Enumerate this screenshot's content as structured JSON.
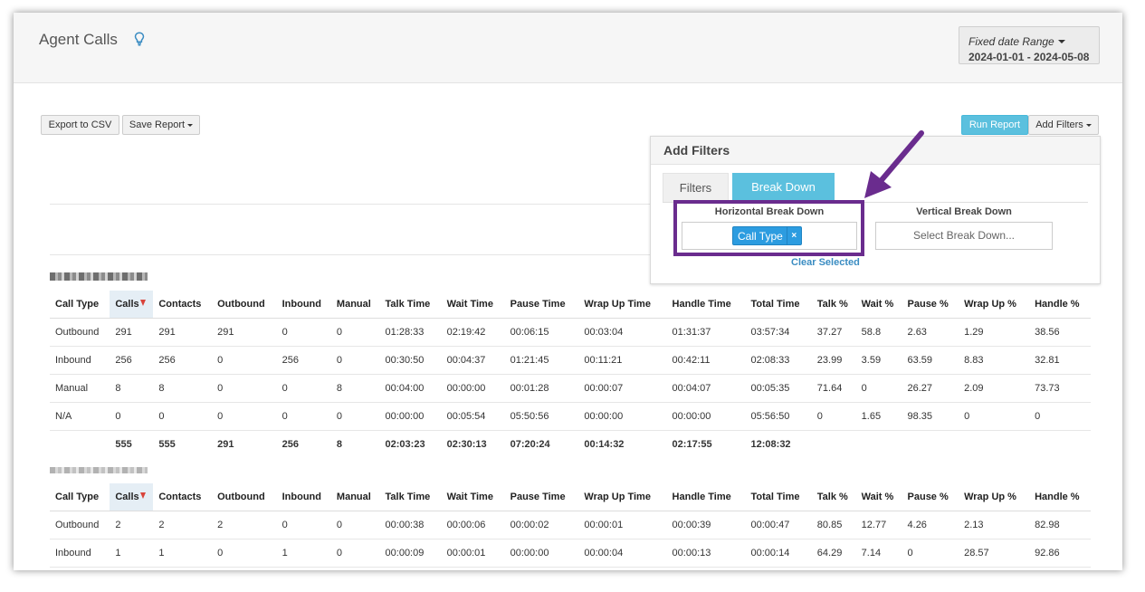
{
  "header": {
    "title": "Agent Calls",
    "date_range_label": "Fixed date Range",
    "date_range_value": "2024-01-01 - 2024-05-08"
  },
  "toolbar": {
    "export_label": "Export to CSV",
    "save_label": "Save Report",
    "run_label": "Run Report",
    "add_filters_label": "Add Filters"
  },
  "filter_panel": {
    "title": "Add Filters",
    "tab_filters": "Filters",
    "tab_breakdown": "Break Down",
    "horizontal_label": "Horizontal Break Down",
    "vertical_label": "Vertical Break Down",
    "chip_label": "Call Type",
    "chip_remove": "×",
    "vertical_placeholder": "Select Break Down...",
    "clear_label": "Clear Selected",
    "highlight_color": "#6a2c8e",
    "accent_color": "#5bc0de"
  },
  "columns": [
    "Call Type",
    "Calls",
    "Contacts",
    "Outbound",
    "Inbound",
    "Manual",
    "Talk Time",
    "Wait Time",
    "Pause Time",
    "Wrap Up Time",
    "Handle Time",
    "Total Time",
    "Talk %",
    "Wait %",
    "Pause %",
    "Wrap Up %",
    "Handle %"
  ],
  "table1": {
    "rows": [
      [
        "Outbound",
        "291",
        "291",
        "291",
        "0",
        "0",
        "01:28:33",
        "02:19:42",
        "00:06:15",
        "00:03:04",
        "01:31:37",
        "03:57:34",
        "37.27",
        "58.8",
        "2.63",
        "1.29",
        "38.56"
      ],
      [
        "Inbound",
        "256",
        "256",
        "0",
        "256",
        "0",
        "00:30:50",
        "00:04:37",
        "01:21:45",
        "00:11:21",
        "00:42:11",
        "02:08:33",
        "23.99",
        "3.59",
        "63.59",
        "8.83",
        "32.81"
      ],
      [
        "Manual",
        "8",
        "8",
        "0",
        "0",
        "8",
        "00:04:00",
        "00:00:00",
        "00:01:28",
        "00:00:07",
        "00:04:07",
        "00:05:35",
        "71.64",
        "0",
        "26.27",
        "2.09",
        "73.73"
      ],
      [
        "N/A",
        "0",
        "0",
        "0",
        "0",
        "0",
        "00:00:00",
        "00:05:54",
        "05:50:56",
        "00:00:00",
        "00:00:00",
        "05:56:50",
        "0",
        "1.65",
        "98.35",
        "0",
        "0"
      ]
    ],
    "total": [
      "",
      "555",
      "555",
      "291",
      "256",
      "8",
      "02:03:23",
      "02:30:13",
      "07:20:24",
      "00:14:32",
      "02:17:55",
      "12:08:32",
      "",
      "",
      "",
      "",
      ""
    ]
  },
  "table2": {
    "rows": [
      [
        "Outbound",
        "2",
        "2",
        "2",
        "0",
        "0",
        "00:00:38",
        "00:00:06",
        "00:00:02",
        "00:00:01",
        "00:00:39",
        "00:00:47",
        "80.85",
        "12.77",
        "4.26",
        "2.13",
        "82.98"
      ],
      [
        "Inbound",
        "1",
        "1",
        "0",
        "1",
        "0",
        "00:00:09",
        "00:00:01",
        "00:00:00",
        "00:00:04",
        "00:00:13",
        "00:00:14",
        "64.29",
        "7.14",
        "0",
        "28.57",
        "92.86"
      ]
    ]
  },
  "icons": {
    "bulb": "lightbulb-icon",
    "sort": "sort-desc-icon",
    "arrow": "annotation-arrow-icon"
  }
}
